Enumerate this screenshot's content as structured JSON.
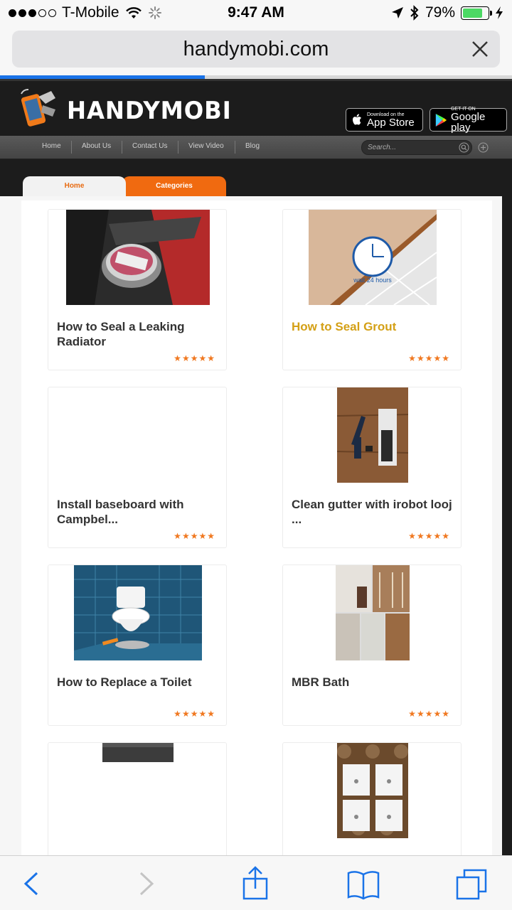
{
  "status": {
    "carrier": "T-Mobile",
    "time": "9:47 AM",
    "battery": "79%",
    "battery_level": 0.79
  },
  "browser": {
    "url": "handymobi.com",
    "load_progress": 0.4
  },
  "site": {
    "logo_text": "HANDYMOBI",
    "appstore": {
      "small": "Download on the",
      "big": "App Store"
    },
    "gplay": {
      "small": "GET IT ON",
      "big": "Google play"
    },
    "nav": [
      "Home",
      "About Us",
      "Contact Us",
      "View Video",
      "Blog"
    ],
    "search_placeholder": "Search...",
    "tabs": {
      "home": "Home",
      "categories": "Categories"
    }
  },
  "cards": [
    {
      "title": "How to Seal a Leaking Radiator",
      "rating": 5
    },
    {
      "title": "How to Seal Grout",
      "rating": 5,
      "thumb_caption": "wait 24 hours"
    },
    {
      "title": "Install baseboard with Campbel...",
      "rating": 5
    },
    {
      "title": "Clean gutter with irobot looj ...",
      "rating": 5
    },
    {
      "title": "How to Replace a Toilet",
      "rating": 5
    },
    {
      "title": "MBR Bath",
      "rating": 5
    }
  ],
  "colors": {
    "accent": "#f06a10",
    "highlight_title": "#d4a016",
    "ios_blue": "#1a73e8"
  }
}
